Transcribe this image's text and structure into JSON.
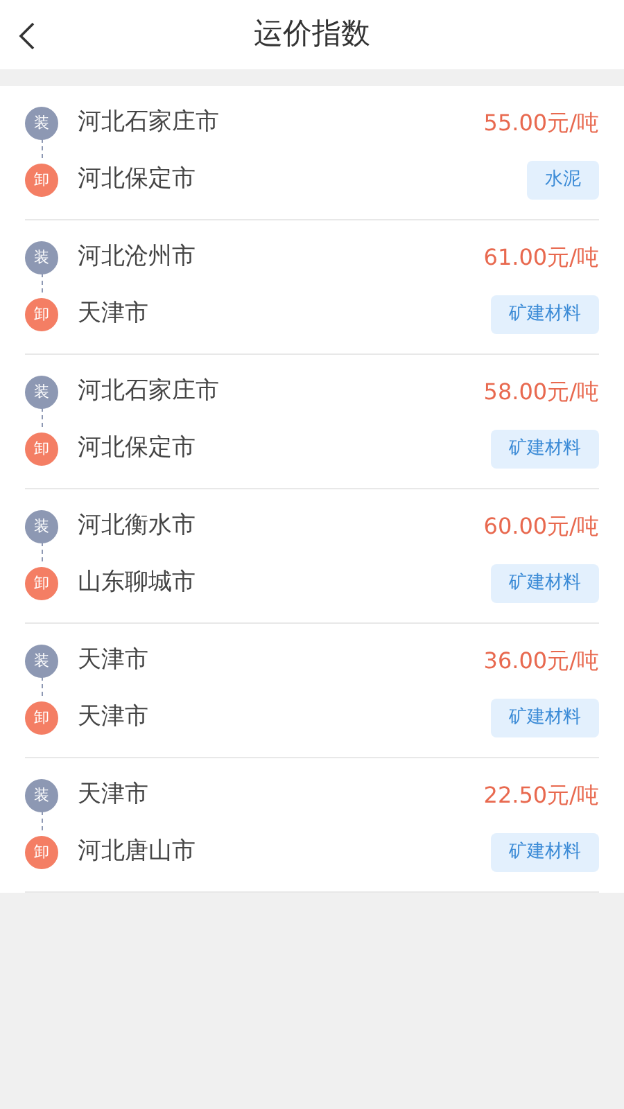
{
  "header": {
    "title": "运价指数"
  },
  "routes": [
    {
      "load_badge": "装",
      "origin": "河北石家庄市",
      "price": "55.00元/吨",
      "unload_badge": "卸",
      "destination": "河北保定市",
      "cargo": "水泥"
    },
    {
      "load_badge": "装",
      "origin": "河北沧州市",
      "price": "61.00元/吨",
      "unload_badge": "卸",
      "destination": "天津市",
      "cargo": "矿建材料"
    },
    {
      "load_badge": "装",
      "origin": "河北石家庄市",
      "price": "58.00元/吨",
      "unload_badge": "卸",
      "destination": "河北保定市",
      "cargo": "矿建材料"
    },
    {
      "load_badge": "装",
      "origin": "河北衡水市",
      "price": "60.00元/吨",
      "unload_badge": "卸",
      "destination": "山东聊城市",
      "cargo": "矿建材料"
    },
    {
      "load_badge": "装",
      "origin": "天津市",
      "price": "36.00元/吨",
      "unload_badge": "卸",
      "destination": "天津市",
      "cargo": "矿建材料"
    },
    {
      "load_badge": "装",
      "origin": "天津市",
      "price": "22.50元/吨",
      "unload_badge": "卸",
      "destination": "河北唐山市",
      "cargo": "矿建材料"
    }
  ]
}
